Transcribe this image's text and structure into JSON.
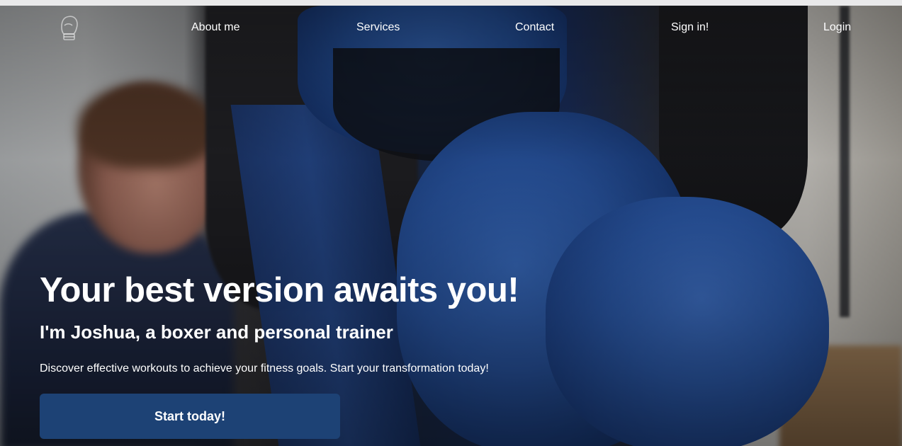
{
  "nav": {
    "logo_icon": "boxing-glove-icon",
    "items": [
      {
        "label": "About me"
      },
      {
        "label": "Services"
      },
      {
        "label": "Contact"
      },
      {
        "label": "Sign in!"
      },
      {
        "label": "Login"
      }
    ]
  },
  "hero": {
    "title": "Your best version awaits you!",
    "subtitle": "I'm Joshua, a boxer and personal trainer",
    "description": "Discover effective workouts to achieve your fitness goals. Start your transformation today!",
    "cta_label": "Start today!",
    "background_image": "boxing-gloves-photo"
  },
  "colors": {
    "cta_background": "#1d4275",
    "text": "#ffffff",
    "page_background": "#e9e9ea"
  }
}
